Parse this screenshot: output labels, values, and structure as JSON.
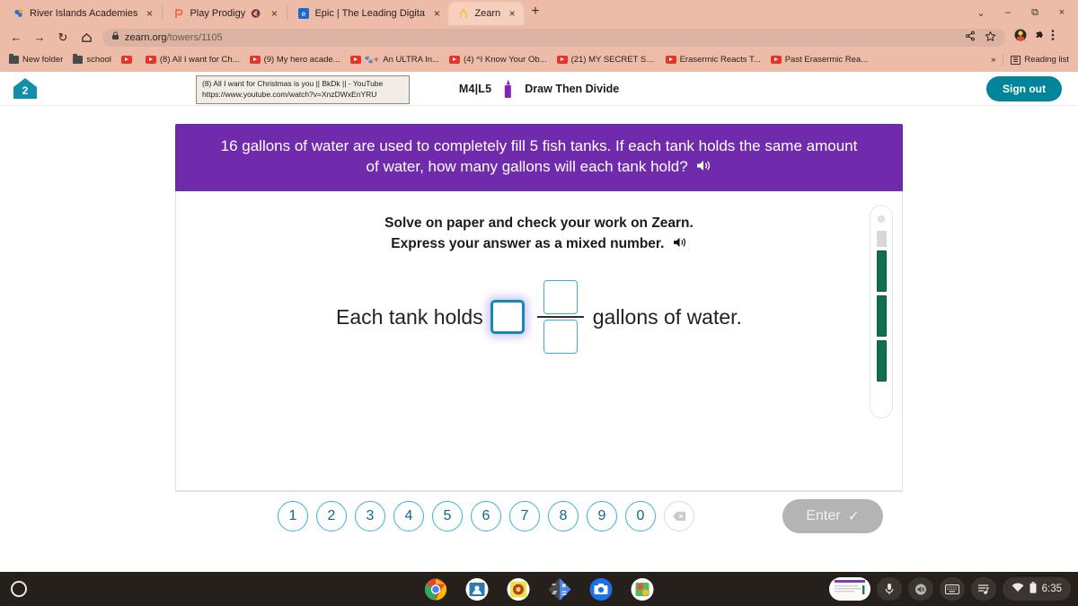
{
  "browser": {
    "tabs": [
      {
        "title": "River Islands Academies",
        "favicon": "riverislands-icon",
        "active": false,
        "muted": false
      },
      {
        "title": "Play Prodigy",
        "favicon": "prodigy-icon",
        "active": false,
        "muted": true
      },
      {
        "title": "Epic | The Leading Digital Library",
        "favicon": "epic-icon",
        "active": false,
        "muted": false
      },
      {
        "title": "Zearn",
        "favicon": "zearn-icon",
        "active": true,
        "muted": false
      }
    ],
    "new_tab_label": "+",
    "close_label": "×",
    "window_controls": {
      "chevron": "⌄",
      "minimize": "–",
      "maximize": "❐",
      "close": "×"
    },
    "nav": {
      "back": "←",
      "forward": "→",
      "reload": "↻",
      "home": "⌂"
    },
    "url": {
      "lock": "lock-icon",
      "domain": "zearn.org",
      "path": "/towers/1105"
    },
    "omnibox_actions": {
      "share": "share-icon",
      "bookmark": "star-icon"
    },
    "toolbar_tail": {
      "profile": "profile-avatar",
      "extensions": "puzzle-icon",
      "menu": "three-dot-menu"
    },
    "bookmarks": [
      {
        "label": "New folder",
        "icon": "folder-icon"
      },
      {
        "label": "school",
        "icon": "folder-icon"
      },
      {
        "label": "",
        "icon": "youtube-icon"
      },
      {
        "label": "(8) All I want for Ch...",
        "icon": "youtube-icon"
      },
      {
        "label": "(9) My hero acade...",
        "icon": "youtube-icon"
      },
      {
        "label": "An ULTRA In...",
        "icon": "youtube-icon"
      },
      {
        "label": "(4) ^I Know Your Ob...",
        "icon": "youtube-icon"
      },
      {
        "label": "(21) MY SECRET SA...",
        "icon": "youtube-icon"
      },
      {
        "label": "Erasermic Reacts T...",
        "icon": "youtube-icon"
      },
      {
        "label": "Past Erasermic Rea...",
        "icon": "youtube-icon"
      }
    ],
    "bookmarks_overflow": "»",
    "reading_list": "Reading list",
    "tooltip": {
      "title": "(8) All I want for Christmas is you || BkDk || - YouTube",
      "url": "https://www.youtube.com/watch?v=XnzDWxEnYRU"
    }
  },
  "app": {
    "logo_name": "zearn-house-logo",
    "lesson_code": "M4|L5",
    "lesson_title": "Draw Then Divide",
    "pencil_icon": "pencil-icon",
    "sign_out": "Sign out",
    "prompt": "16 gallons of water are used to completely fill 5 fish tanks. If each tank holds the same amount of water, how many gallons will each tank hold?",
    "prompt_audio_icon": "speaker-icon",
    "instruction_line1": "Solve on paper and check your work on Zearn.",
    "instruction_line2": "Express your answer as a mixed number.",
    "instruction_audio_icon": "speaker-icon",
    "answer": {
      "lead_text": "Each tank holds",
      "whole_value": "",
      "numerator_value": "",
      "denominator_value": "",
      "trail_text": "gallons of water."
    },
    "numpad": {
      "keys": [
        "1",
        "2",
        "3",
        "4",
        "5",
        "6",
        "7",
        "8",
        "9",
        "0"
      ],
      "backspace_icon": "backspace-icon",
      "enter_label": "Enter",
      "enter_check": "✓"
    },
    "tower": {
      "star_icon": "sparkle-icon",
      "segments": [
        "empty",
        "full",
        "full",
        "full"
      ]
    },
    "colors": {
      "prompt_purple": "#6f2bac",
      "accent_teal": "#00859b",
      "box_blue": "#1489b8",
      "frac_blue": "#3ab3d6",
      "tower_green": "#10704b",
      "enter_gray": "#b4b4b4"
    }
  },
  "shelf": {
    "launcher": "launcher-button",
    "apps": [
      "chrome-icon",
      "classroom-icon",
      "game-icon",
      "calculator-icon",
      "camera-icon",
      "sticker-app-icon"
    ],
    "status": {
      "window_thumb": "window-preview",
      "mic": "microphone-icon",
      "volume": "volume-muted-icon",
      "keyboard": "keyboard-icon",
      "media": "media-playlist-icon",
      "wifi": "wifi-icon",
      "battery": "battery-icon",
      "time": "6:35"
    }
  }
}
